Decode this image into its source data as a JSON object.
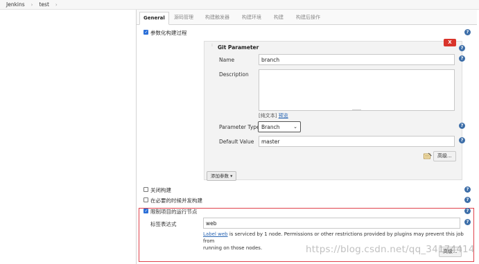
{
  "breadcrumb": {
    "items": [
      "Jenkins",
      "test"
    ],
    "separator": "›"
  },
  "tabs": [
    {
      "label": "General",
      "active": true
    },
    {
      "label": "源码管理",
      "active": false
    },
    {
      "label": "构建触发器",
      "active": false
    },
    {
      "label": "构建环境",
      "active": false
    },
    {
      "label": "构建",
      "active": false
    },
    {
      "label": "构建后操作",
      "active": false
    }
  ],
  "parameterized": {
    "label": "参数化构建过程",
    "checked": true
  },
  "git_parameter": {
    "title": "Git Parameter",
    "delete_label": "X",
    "name_label": "Name",
    "name_value": "branch",
    "description_label": "Description",
    "description_value": "",
    "plain_text_label": "[纯文本]",
    "preview_label": "预览",
    "param_type_label": "Parameter Type",
    "param_type_value": "Branch",
    "default_value_label": "Default Value",
    "default_value": "master",
    "advanced_label": "高级..."
  },
  "add_param_label": "添加参数",
  "options": [
    {
      "label": "关闭构建",
      "checked": false
    },
    {
      "label": "在必要的时候并发构建",
      "checked": false
    },
    {
      "label": "限制项目的运行节点",
      "checked": true
    }
  ],
  "restrict": {
    "label_expr_label": "标签表达式",
    "label_expr_value": "web",
    "link_text": "Label web",
    "desc_text_1": " is serviced by 1 node. Permissions or other restrictions provided by plugins may prevent this job from",
    "desc_text_2": "running on those nodes.",
    "advanced_label": "高级..."
  },
  "watermark": "https://blog.csdn.net/qq_34174414",
  "colors": {
    "accent": "#2b6fd8",
    "help": "#3d6ea8",
    "danger": "#d9342b",
    "highlight": "#e0414b"
  },
  "icons": [
    "chevron-right-icon",
    "help-icon",
    "checkbox-icon",
    "grip-icon",
    "dropdown-arrow-icon",
    "notepad-icon"
  ]
}
